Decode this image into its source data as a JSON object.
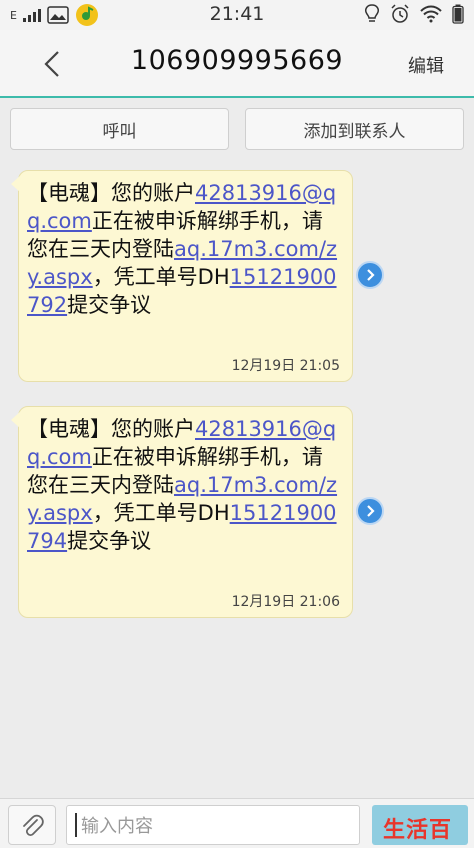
{
  "status_bar": {
    "network": "E",
    "time": "21:41",
    "icons": [
      "signal-icon",
      "gallery-icon",
      "music-app-icon",
      "bulb-icon",
      "alarm-icon",
      "wifi-icon",
      "battery-icon"
    ]
  },
  "header": {
    "title": "106909995669",
    "edit_label": "编辑"
  },
  "actions": {
    "call_label": "呼叫",
    "add_contact_label": "添加到联系人"
  },
  "messages": [
    {
      "text_1": "【电魂】您的账户",
      "link_email": "42813916@qq.com",
      "text_2": "正在被申诉解绑手机，请您在三天内登陆",
      "link_url": "aq.17m3.com/zy.aspx",
      "text_3": "，凭工单号DH",
      "link_ticket": "15121900792",
      "text_4": "提交争议",
      "time": "12月19日 21:05"
    },
    {
      "text_1": "【电魂】您的账户",
      "link_email": "42813916@qq.com",
      "text_2": "正在被申诉解绑手机，请您在三天内登陆",
      "link_url": "aq.17m3.com/zy.aspx",
      "text_3": "，凭工单号DH",
      "link_ticket": "15121900794",
      "text_4": "提交争议",
      "time": "12月19日 21:06"
    }
  ],
  "input": {
    "placeholder": "输入内容"
  },
  "watermark": "生活百科",
  "colors": {
    "accent": "#3dbbab",
    "bubble": "#fdf8d3",
    "link": "#4c56c8",
    "send": "#8fcde0"
  }
}
